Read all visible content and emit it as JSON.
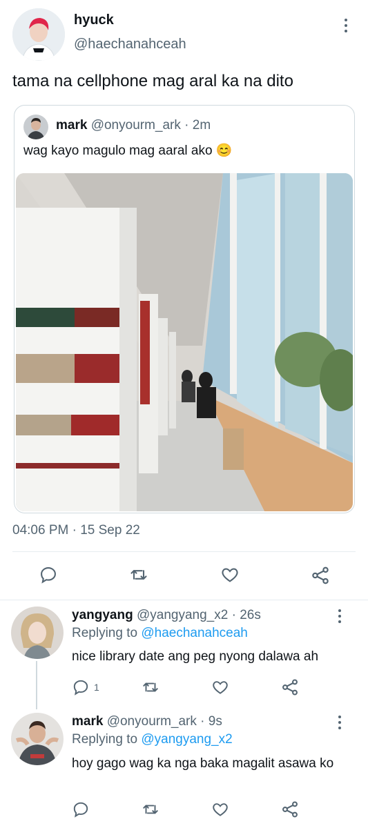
{
  "main_tweet": {
    "display_name": "hyuck",
    "handle": "@haechanahceah",
    "text": "tama na cellphone mag aral ka na dito",
    "timestamp": "04:06 PM · 15 Sep 22"
  },
  "quoted_tweet": {
    "display_name": "mark",
    "handle": "@onyourm_ark",
    "time": "· 2m",
    "text": "wag kayo magulo mag aaral ako",
    "emoji": "😊"
  },
  "replies": [
    {
      "display_name": "yangyang",
      "handle": "@yangyang_x2",
      "time": "· 26s",
      "replying_prefix": "Replying to",
      "replying_to": "@haechanahceah",
      "text": "nice library date ang peg nyong dalawa ah",
      "reply_count": "1"
    },
    {
      "display_name": "mark",
      "handle": "@onyourm_ark",
      "time": "· 9s",
      "replying_prefix": "Replying to",
      "replying_to": "@yangyang_x2",
      "text": "hoy gago wag ka nga baka magalit asawa ko",
      "reply_count": ""
    }
  ],
  "icons": [
    "more-icon",
    "reply-icon",
    "retweet-icon",
    "like-icon",
    "share-icon"
  ]
}
